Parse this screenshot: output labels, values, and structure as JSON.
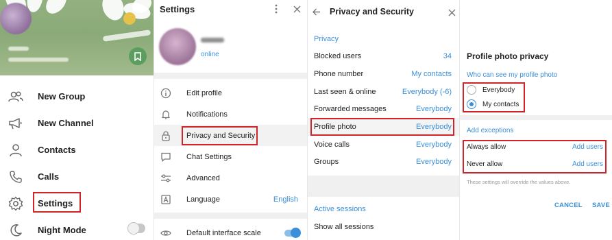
{
  "menu": {
    "items": [
      {
        "label": "New Group",
        "icon": "group-icon"
      },
      {
        "label": "New Channel",
        "icon": "megaphone-icon"
      },
      {
        "label": "Contacts",
        "icon": "person-icon"
      },
      {
        "label": "Calls",
        "icon": "phone-icon"
      },
      {
        "label": "Settings",
        "icon": "gear-icon"
      },
      {
        "label": "Night Mode",
        "icon": "moon-icon"
      }
    ],
    "night_mode_on": false
  },
  "settings": {
    "title": "Settings",
    "status": "online",
    "items": [
      {
        "label": "Edit profile",
        "icon": "info-icon"
      },
      {
        "label": "Notifications",
        "icon": "bell-icon"
      },
      {
        "label": "Privacy and Security",
        "icon": "lock-icon"
      },
      {
        "label": "Chat Settings",
        "icon": "chat-icon"
      },
      {
        "label": "Advanced",
        "icon": "sliders-icon"
      },
      {
        "label": "Language",
        "icon": "language-icon",
        "value": "English"
      },
      {
        "label": "Default interface scale",
        "icon": "eye-icon"
      }
    ],
    "interface_scale_on": true
  },
  "privacy": {
    "title": "Privacy and Security",
    "section_privacy": "Privacy",
    "rows": [
      {
        "label": "Blocked users",
        "value": "34"
      },
      {
        "label": "Phone number",
        "value": "My contacts"
      },
      {
        "label": "Last seen & online",
        "value": "Everybody (-6)"
      },
      {
        "label": "Forwarded messages",
        "value": "Everybody"
      },
      {
        "label": "Profile photo",
        "value": "Everybody"
      },
      {
        "label": "Voice calls",
        "value": "Everybody"
      },
      {
        "label": "Groups",
        "value": "Everybody"
      }
    ],
    "section_sessions": "Active sessions",
    "show_sessions": "Show all sessions"
  },
  "photo_privacy": {
    "title": "Profile photo privacy",
    "question": "Who can see my profile photo",
    "options": [
      {
        "label": "Everybody",
        "selected": false
      },
      {
        "label": "My contacts",
        "selected": true
      }
    ],
    "exceptions_header": "Add exceptions",
    "exceptions": [
      {
        "label": "Always allow",
        "action": "Add users"
      },
      {
        "label": "Never allow",
        "action": "Add users"
      }
    ],
    "note": "These settings will override the values above.",
    "cancel": "CANCEL",
    "save": "SAVE"
  },
  "colors": {
    "accent": "#3a8fd8",
    "highlight_box": "#d0232a",
    "cover_green": "#8aaa78",
    "saved_button": "#5c9e60"
  }
}
